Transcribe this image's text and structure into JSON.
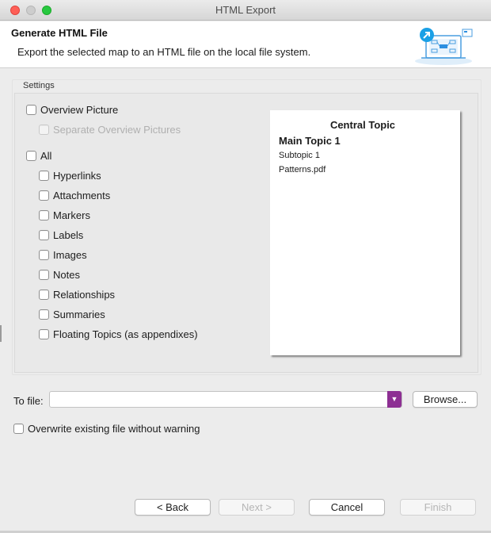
{
  "window": {
    "title": "HTML Export"
  },
  "header": {
    "title": "Generate HTML File",
    "description": "Export the selected map to an HTML file on the local file system.",
    "illustration_icon": "export-to-html-illustration-icon"
  },
  "settings": {
    "group_label": "Settings",
    "overview_picture": {
      "label": "Overview Picture",
      "checked": false
    },
    "separate_overview": {
      "label": "Separate Overview Pictures",
      "checked": false,
      "enabled": false
    },
    "all": {
      "label": "All",
      "checked": false
    },
    "options": [
      {
        "label": "Hyperlinks",
        "checked": false
      },
      {
        "label": "Attachments",
        "checked": false
      },
      {
        "label": "Markers",
        "checked": false
      },
      {
        "label": "Labels",
        "checked": false
      },
      {
        "label": "Images",
        "checked": false
      },
      {
        "label": "Notes",
        "checked": false
      },
      {
        "label": "Relationships",
        "checked": false
      },
      {
        "label": "Summaries",
        "checked": false
      },
      {
        "label": "Floating Topics (as appendixes)",
        "checked": false
      }
    ]
  },
  "preview": {
    "central_topic": "Central Topic",
    "main_topic": "Main Topic 1",
    "subtopic": "Subtopic 1",
    "attachment": "Patterns.pdf"
  },
  "output": {
    "to_file_label": "To file:",
    "file_value": "",
    "browse_label": "Browse...",
    "combo_accent": "#8d2f93",
    "overwrite": {
      "label": "Overwrite existing file without warning",
      "checked": false
    }
  },
  "buttons": {
    "back": "< Back",
    "next": "Next >",
    "cancel": "Cancel",
    "finish": "Finish"
  }
}
